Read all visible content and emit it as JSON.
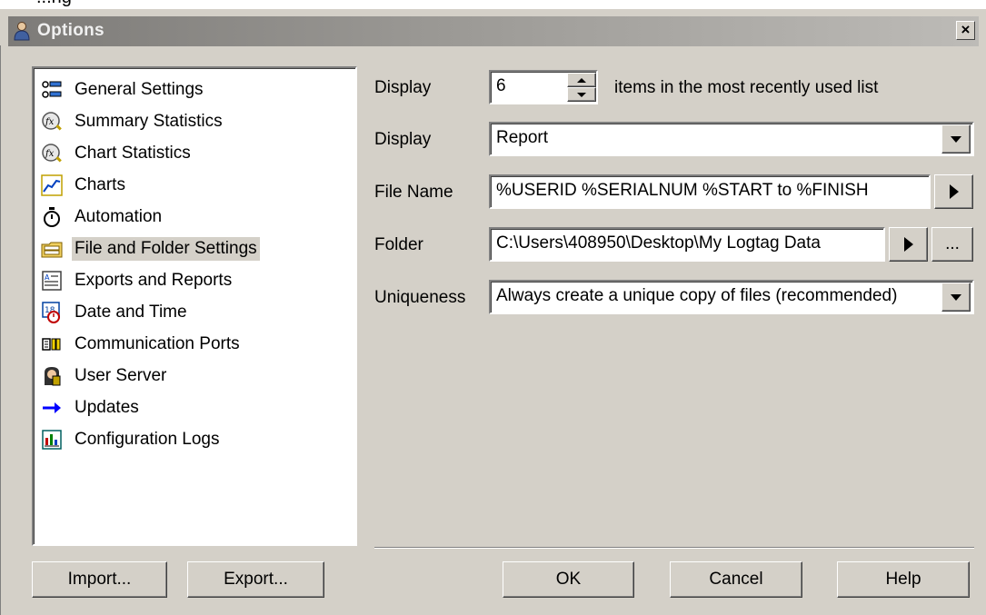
{
  "background_strip_text": "...ng",
  "window": {
    "title": "Options",
    "close_glyph": "×"
  },
  "nav": {
    "items": [
      {
        "label": "General Settings",
        "icon": "general-settings-icon"
      },
      {
        "label": "Summary Statistics",
        "icon": "fx-magnifier-icon"
      },
      {
        "label": "Chart Statistics",
        "icon": "fx-magnifier-icon"
      },
      {
        "label": "Charts",
        "icon": "line-chart-icon"
      },
      {
        "label": "Automation",
        "icon": "stopwatch-icon"
      },
      {
        "label": "File and Folder Settings",
        "icon": "folder-settings-icon"
      },
      {
        "label": "Exports and Reports",
        "icon": "report-icon"
      },
      {
        "label": "Date and Time",
        "icon": "calendar-clock-icon"
      },
      {
        "label": "Communication Ports",
        "icon": "port-icon"
      },
      {
        "label": "User Server",
        "icon": "user-server-icon"
      },
      {
        "label": "Updates",
        "icon": "arrow-right-icon"
      },
      {
        "label": "Configuration Logs",
        "icon": "config-log-icon"
      }
    ],
    "selected": "File and Folder Settings"
  },
  "settings": {
    "mru_label": "Display",
    "mru_value": "6",
    "mru_suffix": "items in the most recently used list",
    "display_label": "Display",
    "display_value": "Report",
    "filename_label": "File Name",
    "filename_value": "%USERID %SERIALNUM %START to %FINISH",
    "folder_label": "Folder",
    "folder_value": "C:\\Users\\408950\\Desktop\\My Logtag Data",
    "folder_browse_label": "...",
    "uniqueness_label": "Uniqueness",
    "uniqueness_value": "Always create a unique copy of files (recommended)"
  },
  "buttons": {
    "import": "Import...",
    "export": "Export...",
    "ok": "OK",
    "cancel": "Cancel",
    "help": "Help"
  },
  "colors": {
    "dialog_bg": "#d4d0c8",
    "selected_item_bg": "#d4d0c8",
    "updates_arrow": "#0000ff"
  }
}
